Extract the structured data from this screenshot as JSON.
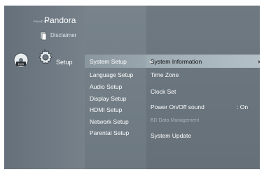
{
  "brand": {
    "logo_small": "PANDORA",
    "logo": "Pandora"
  },
  "source_menu": {
    "disc_label": "Disclaimer",
    "active_label": "Setup"
  },
  "setup_menu": {
    "items": [
      {
        "label": "System Setup",
        "selected": true
      },
      {
        "label": "Language Setup"
      },
      {
        "label": "Audio Setup"
      },
      {
        "label": "Display Setup"
      },
      {
        "label": "HDMI Setup"
      },
      {
        "label": "Network Setup"
      },
      {
        "label": "Parental Setup"
      }
    ]
  },
  "system_menu": {
    "items": [
      {
        "label": "System Information",
        "selected": true
      },
      {
        "label": "Time Zone"
      },
      {
        "label": "Clock Set"
      },
      {
        "label": "Power On/Off sound",
        "value": ": On"
      },
      {
        "label": "BD Data Management",
        "disabled": true
      },
      {
        "label": "System Update"
      }
    ]
  },
  "colors": {
    "panel": "#6e7880",
    "highlight": "#b4c0c8"
  },
  "icons": {
    "dvd": "dvd-disc-icon",
    "gear": "gear-icon",
    "disc": "disc-icon",
    "arrow": "triangle-right-icon"
  }
}
